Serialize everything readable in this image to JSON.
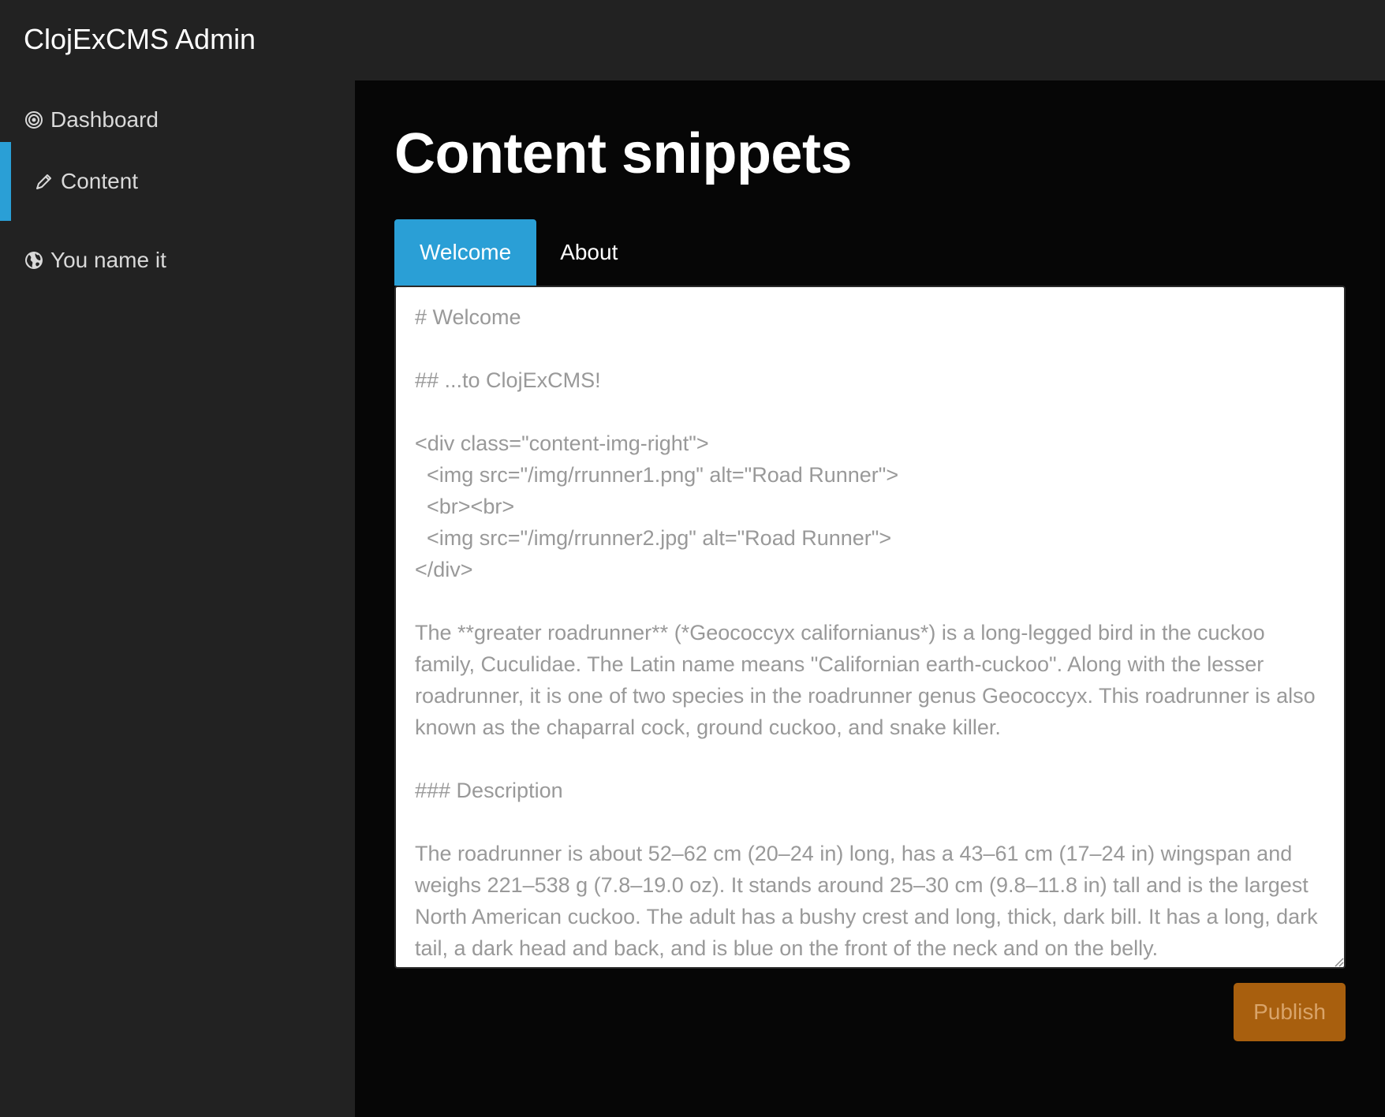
{
  "app": {
    "brand": "ClojExCMS Admin"
  },
  "sidebar": {
    "items": [
      {
        "label": "Dashboard",
        "icon": "target-icon",
        "active": false
      },
      {
        "label": "Content",
        "icon": "pencil-icon",
        "active": true
      },
      {
        "label": "You name it",
        "icon": "globe-icon",
        "active": false
      }
    ]
  },
  "main": {
    "title": "Content snippets",
    "tabs": [
      {
        "label": "Welcome",
        "active": true
      },
      {
        "label": "About",
        "active": false
      }
    ],
    "editor_value": "# Welcome\n\n## ...to ClojExCMS!\n\n<div class=\"content-img-right\">\n  <img src=\"/img/rrunner1.png\" alt=\"Road Runner\">\n  <br><br>\n  <img src=\"/img/rrunner2.jpg\" alt=\"Road Runner\">\n</div>\n\nThe **greater roadrunner** (*Geococcyx californianus*) is a long-legged bird in the cuckoo family, Cuculidae. The Latin name means \"Californian earth-cuckoo\". Along with the lesser roadrunner, it is one of two species in the roadrunner genus Geococcyx. This roadrunner is also known as the chaparral cock, ground cuckoo, and snake killer.\n\n### Description\n\nThe roadrunner is about 52–62 cm (20–24 in) long, has a 43–61 cm (17–24 in) wingspan and weighs 221–538 g (7.8–19.0 oz). It stands around 25–30 cm (9.8–11.8 in) tall and is the largest North American cuckoo. The adult has a bushy crest and long, thick, dark bill. It has a long, dark tail, a dark head and back, and is blue on the front of the neck and on the belly.",
    "publish_label": "Publish"
  },
  "colors": {
    "accent": "#2a9fd6",
    "publish": "#a85f0e",
    "sidebar_bg": "#222222",
    "main_bg": "#060606"
  }
}
